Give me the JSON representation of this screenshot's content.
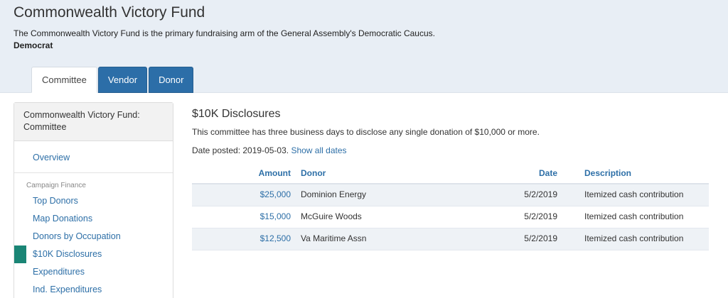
{
  "header": {
    "title": "Commonwealth Victory Fund",
    "description": "The Commonwealth Victory Fund is the primary fundraising arm of the General Assembly's Democratic Caucus.",
    "party": "Democrat"
  },
  "tabs": [
    {
      "label": "Committee",
      "active": true
    },
    {
      "label": "Vendor",
      "active": false
    },
    {
      "label": "Donor",
      "active": false
    }
  ],
  "sidebar": {
    "header": "Commonwealth Victory Fund: Committee",
    "overview": "Overview",
    "section_label": "Campaign Finance",
    "items": [
      {
        "label": "Top Donors"
      },
      {
        "label": "Map Donations"
      },
      {
        "label": "Donors by Occupation"
      },
      {
        "label": "$10K Disclosures"
      },
      {
        "label": "Expenditures"
      },
      {
        "label": "Ind. Expenditures"
      }
    ],
    "active_index": 3,
    "accent_color": "#1a8575"
  },
  "main": {
    "title": "$10K Disclosures",
    "description": "This committee has three business days to disclose any single donation of $10,000 or more.",
    "date_posted_prefix": "Date posted: 2019-05-03.",
    "show_all_link": "Show all dates"
  },
  "table": {
    "headers": {
      "amount": "Amount",
      "donor": "Donor",
      "date": "Date",
      "description": "Description"
    },
    "rows": [
      {
        "amount": "$25,000",
        "donor": "Dominion Energy",
        "date": "5/2/2019",
        "description": "Itemized cash contribution"
      },
      {
        "amount": "$15,000",
        "donor": "McGuire Woods",
        "date": "5/2/2019",
        "description": "Itemized cash contribution"
      },
      {
        "amount": "$12,500",
        "donor": "Va Maritime Assn",
        "date": "5/2/2019",
        "description": "Itemized cash contribution"
      }
    ]
  },
  "colors": {
    "link": "#2d6fa7",
    "tab_blue": "#2c6ea8",
    "hero_bg": "#e8eef5"
  }
}
